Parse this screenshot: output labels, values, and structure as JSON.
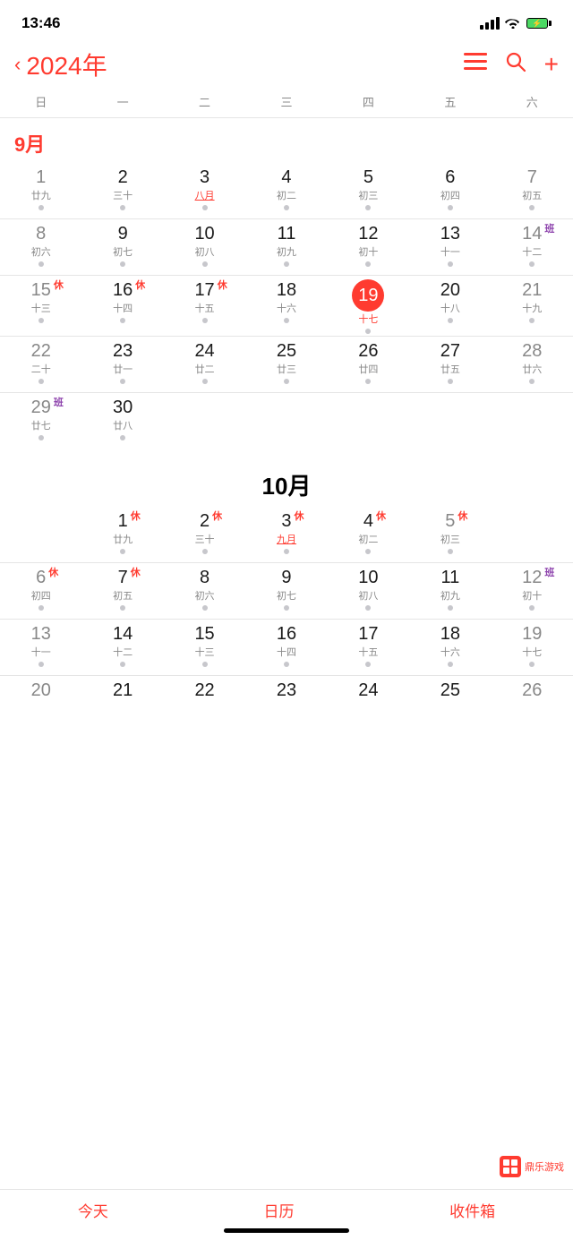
{
  "statusBar": {
    "time": "13:46"
  },
  "header": {
    "backLabel": "‹",
    "yearLabel": "2024年",
    "listIcon": "list-icon",
    "searchIcon": "search-icon",
    "addIcon": "add-icon"
  },
  "weekdays": [
    "日",
    "一",
    "二",
    "三",
    "四",
    "五",
    "六"
  ],
  "months": {
    "sep": {
      "label": "9月",
      "weeks": [
        [
          {
            "day": "1",
            "lunar": "廿九",
            "dot": true,
            "sunday": true
          },
          {
            "day": "2",
            "lunar": "三十",
            "dot": true
          },
          {
            "day": "3",
            "lunar": "八月",
            "dot": true,
            "underline": true
          },
          {
            "day": "4",
            "lunar": "初二",
            "dot": true
          },
          {
            "day": "5",
            "lunar": "初三",
            "dot": true
          },
          {
            "day": "6",
            "lunar": "初四",
            "dot": true
          },
          {
            "day": "7",
            "lunar": "初五",
            "dot": true,
            "saturday": true
          }
        ],
        [
          {
            "day": "8",
            "lunar": "初六",
            "dot": true,
            "sunday": true
          },
          {
            "day": "9",
            "lunar": "初七",
            "dot": true
          },
          {
            "day": "10",
            "lunar": "初八",
            "dot": true
          },
          {
            "day": "11",
            "lunar": "初九",
            "dot": true
          },
          {
            "day": "12",
            "lunar": "初十",
            "dot": true
          },
          {
            "day": "13",
            "lunar": "十一",
            "dot": true
          },
          {
            "day": "14",
            "lunar": "十二",
            "dot": true,
            "saturday": true,
            "badge": "班",
            "badgeType": "ban"
          }
        ],
        [
          {
            "day": "15",
            "lunar": "十三",
            "dot": true,
            "sunday": true,
            "badge": "休",
            "badgeType": "xiu"
          },
          {
            "day": "16",
            "lunar": "十四",
            "dot": true,
            "badge": "休",
            "badgeType": "xiu"
          },
          {
            "day": "17",
            "lunar": "十五",
            "dot": true,
            "badge": "休",
            "badgeType": "xiu"
          },
          {
            "day": "18",
            "lunar": "十六",
            "dot": true
          },
          {
            "day": "19",
            "lunar": "十七",
            "dot": true,
            "today": true
          },
          {
            "day": "20",
            "lunar": "十八",
            "dot": true
          },
          {
            "day": "21",
            "lunar": "十九",
            "dot": true,
            "saturday": true
          }
        ],
        [
          {
            "day": "22",
            "lunar": "二十",
            "dot": true,
            "sunday": true
          },
          {
            "day": "23",
            "lunar": "廿一",
            "dot": true
          },
          {
            "day": "24",
            "lunar": "廿二",
            "dot": true
          },
          {
            "day": "25",
            "lunar": "廿三",
            "dot": true
          },
          {
            "day": "26",
            "lunar": "廿四",
            "dot": true
          },
          {
            "day": "27",
            "lunar": "廿五",
            "dot": true
          },
          {
            "day": "28",
            "lunar": "廿六",
            "dot": true,
            "saturday": true
          }
        ],
        [
          {
            "day": "29",
            "lunar": "廿七",
            "dot": true,
            "sunday": true,
            "badge": "班",
            "badgeType": "ban"
          },
          {
            "day": "30",
            "lunar": "廿八",
            "dot": true
          },
          {
            "day": "",
            "lunar": "",
            "dot": false
          },
          {
            "day": "",
            "lunar": "",
            "dot": false
          },
          {
            "day": "",
            "lunar": "",
            "dot": false
          },
          {
            "day": "",
            "lunar": "",
            "dot": false
          },
          {
            "day": "",
            "lunar": "",
            "dot": false
          }
        ]
      ]
    },
    "oct": {
      "label": "10月",
      "weeks": [
        [
          {
            "day": "",
            "lunar": "",
            "dot": false
          },
          {
            "day": "1",
            "lunar": "廿九",
            "dot": true,
            "badge": "休",
            "badgeType": "xiu"
          },
          {
            "day": "2",
            "lunar": "三十",
            "dot": true,
            "badge": "休",
            "badgeType": "xiu"
          },
          {
            "day": "3",
            "lunar": "九月",
            "dot": true,
            "badge": "休",
            "badgeType": "xiu",
            "underline": true
          },
          {
            "day": "4",
            "lunar": "初二",
            "dot": true,
            "badge": "休",
            "badgeType": "xiu"
          },
          {
            "day": "5",
            "lunar": "初三",
            "dot": true,
            "badge": "休",
            "badgeType": "xiu",
            "saturday": true
          },
          {
            "day": "",
            "lunar": "",
            "dot": false
          }
        ],
        [
          {
            "day": "6",
            "lunar": "初四",
            "dot": true,
            "sunday": true,
            "badge": "休",
            "badgeType": "xiu"
          },
          {
            "day": "7",
            "lunar": "初五",
            "dot": true,
            "badge": "休",
            "badgeType": "xiu"
          },
          {
            "day": "8",
            "lunar": "初六",
            "dot": true
          },
          {
            "day": "9",
            "lunar": "初七",
            "dot": true
          },
          {
            "day": "10",
            "lunar": "初八",
            "dot": true
          },
          {
            "day": "11",
            "lunar": "初九",
            "dot": true
          },
          {
            "day": "12",
            "lunar": "初十",
            "dot": true,
            "saturday": true,
            "badge": "班",
            "badgeType": "ban"
          }
        ],
        [
          {
            "day": "13",
            "lunar": "十一",
            "dot": true,
            "sunday": true
          },
          {
            "day": "14",
            "lunar": "十二",
            "dot": true
          },
          {
            "day": "15",
            "lunar": "十三",
            "dot": true
          },
          {
            "day": "16",
            "lunar": "十四",
            "dot": true
          },
          {
            "day": "17",
            "lunar": "十五",
            "dot": true
          },
          {
            "day": "18",
            "lunar": "十六",
            "dot": true
          },
          {
            "day": "19",
            "lunar": "十七",
            "dot": true,
            "saturday": true
          }
        ],
        [
          {
            "day": "20",
            "lunar": "",
            "dot": false,
            "sunday": true
          },
          {
            "day": "21",
            "lunar": "",
            "dot": false
          },
          {
            "day": "22",
            "lunar": "",
            "dot": false
          },
          {
            "day": "23",
            "lunar": "",
            "dot": false
          },
          {
            "day": "24",
            "lunar": "",
            "dot": false
          },
          {
            "day": "25",
            "lunar": "",
            "dot": false
          },
          {
            "day": "26",
            "lunar": "",
            "dot": false,
            "saturday": true
          }
        ]
      ]
    }
  },
  "bottomNav": {
    "today": "今天",
    "calendar": "日历",
    "inbox": "收件箱"
  },
  "watermark": {
    "text": "鼎乐游戏"
  }
}
